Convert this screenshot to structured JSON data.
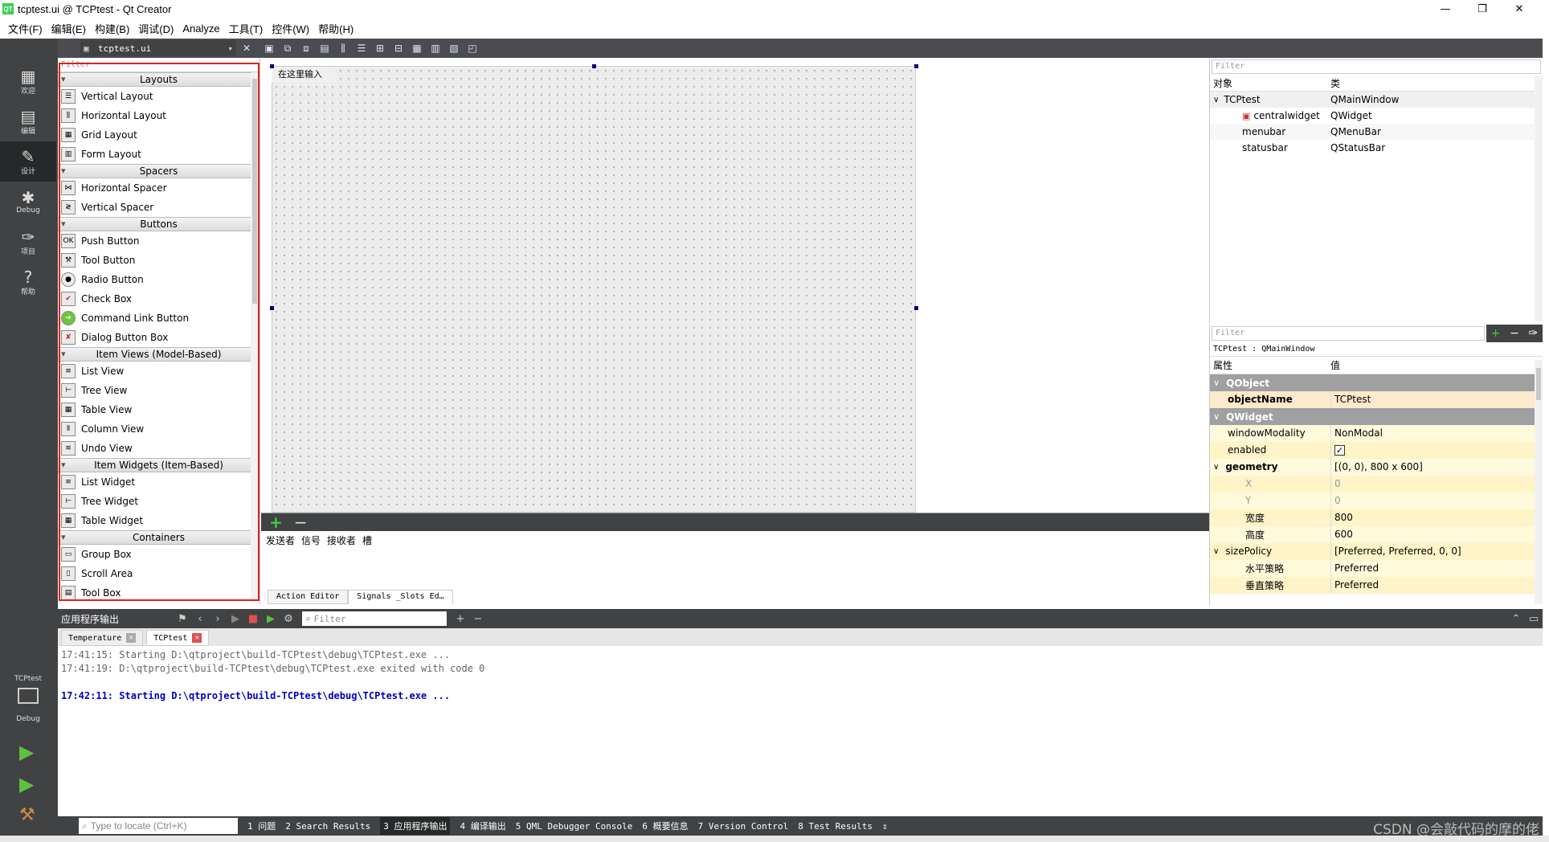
{
  "window": {
    "title": "tcptest.ui @ TCPtest - Qt Creator",
    "logo": "QT",
    "minimize": "—",
    "maximize": "❐",
    "close": "✕"
  },
  "menu": [
    "文件(F)",
    "编辑(E)",
    "构建(B)",
    "调试(D)",
    "Analyze",
    "工具(T)",
    "控件(W)",
    "帮助(H)"
  ],
  "modes": [
    {
      "label": "欢迎",
      "icon": "grid-icon"
    },
    {
      "label": "编辑",
      "icon": "document-icon"
    },
    {
      "label": "设计",
      "icon": "pencil-icon"
    },
    {
      "label": "Debug",
      "icon": "bug-icon"
    },
    {
      "label": "项目",
      "icon": "wrench-icon"
    },
    {
      "label": "帮助",
      "icon": "help-icon"
    }
  ],
  "design_toolbar": {
    "file": "tcptest.ui"
  },
  "widgetbox": {
    "filter_placeholder": "Filter",
    "categories": [
      {
        "name": "Layouts",
        "items": [
          "Vertical Layout",
          "Horizontal Layout",
          "Grid Layout",
          "Form Layout"
        ]
      },
      {
        "name": "Spacers",
        "items": [
          "Horizontal Spacer",
          "Vertical Spacer"
        ]
      },
      {
        "name": "Buttons",
        "items": [
          "Push Button",
          "Tool Button",
          "Radio Button",
          "Check Box",
          "Command Link Button",
          "Dialog Button Box"
        ]
      },
      {
        "name": "Item Views (Model-Based)",
        "items": [
          "List View",
          "Tree View",
          "Table View",
          "Column View",
          "Undo View"
        ]
      },
      {
        "name": "Item Widgets (Item-Based)",
        "items": [
          "List Widget",
          "Tree Widget",
          "Table Widget"
        ]
      },
      {
        "name": "Containers",
        "items": [
          "Group Box",
          "Scroll Area",
          "Tool Box"
        ]
      }
    ]
  },
  "form": {
    "menu_placeholder": "在这里输入"
  },
  "action_panel": {
    "columns": [
      "发送者",
      "信号",
      "接收者",
      "槽"
    ],
    "tabs": [
      "Action Editor",
      "Signals _Slots Ed…"
    ]
  },
  "object_inspector": {
    "filter_placeholder": "Filter",
    "headers": {
      "object": "对象",
      "class": "类"
    },
    "rows": [
      {
        "object": "TCPtest",
        "class": "QMainWindow",
        "level": 0
      },
      {
        "object": "centralwidget",
        "class": "QWidget",
        "level": 2
      },
      {
        "object": "menubar",
        "class": "QMenuBar",
        "level": 1
      },
      {
        "object": "statusbar",
        "class": "QStatusBar",
        "level": 1
      }
    ]
  },
  "property_editor": {
    "filter_placeholder": "Filter",
    "class_label": "TCPtest : QMainWindow",
    "headers": {
      "property": "属性",
      "value": "值"
    },
    "groups": {
      "qobject": "QObject",
      "qwidget": "QWidget"
    },
    "props": {
      "objectName": {
        "k": "objectName",
        "v": "TCPtest"
      },
      "windowModality": {
        "k": "windowModality",
        "v": "NonModal"
      },
      "enabled": {
        "k": "enabled",
        "v": "✓"
      },
      "geometry": {
        "k": "geometry",
        "v": "[(0, 0), 800 x 600]"
      },
      "x": {
        "k": "X",
        "v": "0"
      },
      "y": {
        "k": "Y",
        "v": "0"
      },
      "width": {
        "k": "宽度",
        "v": "800"
      },
      "height": {
        "k": "高度",
        "v": "600"
      },
      "sizePolicy": {
        "k": "sizePolicy",
        "v": "[Preferred, Preferred, 0, 0]"
      },
      "hpolicy": {
        "k": "水平策略",
        "v": "Preferred"
      },
      "vpolicy": {
        "k": "垂直策略",
        "v": "Preferred"
      }
    }
  },
  "output": {
    "title": "应用程序输出",
    "filter_placeholder": "Filter",
    "tabs": [
      {
        "label": "Temperature",
        "active": false
      },
      {
        "label": "TCPtest",
        "active": true
      }
    ],
    "lines": [
      {
        "text": "17:41:15: Starting D:\\qtproject\\build-TCPtest\\debug\\TCPtest.exe ...",
        "style": "gray"
      },
      {
        "text": "17:41:19: D:\\qtproject\\build-TCPtest\\debug\\TCPtest.exe exited with code 0",
        "style": "gray"
      },
      {
        "text": "",
        "style": "gray"
      },
      {
        "text": "17:42:11: Starting D:\\qtproject\\build-TCPtest\\debug\\TCPtest.exe ...",
        "style": "blue"
      }
    ]
  },
  "run_panel": {
    "project": "TCPtest",
    "mode": "Debug"
  },
  "statusbar": {
    "locator_placeholder": "Type to locate (Ctrl+K)",
    "tabs": [
      "1 问题",
      "2 Search Results",
      "3 应用程序输出",
      "4 编译输出",
      "5 QML Debugger Console",
      "6 概要信息",
      "7 Version Control",
      "8 Test Results"
    ],
    "active_tab": 2
  },
  "watermark": "CSDN @会敲代码的摩的佬"
}
